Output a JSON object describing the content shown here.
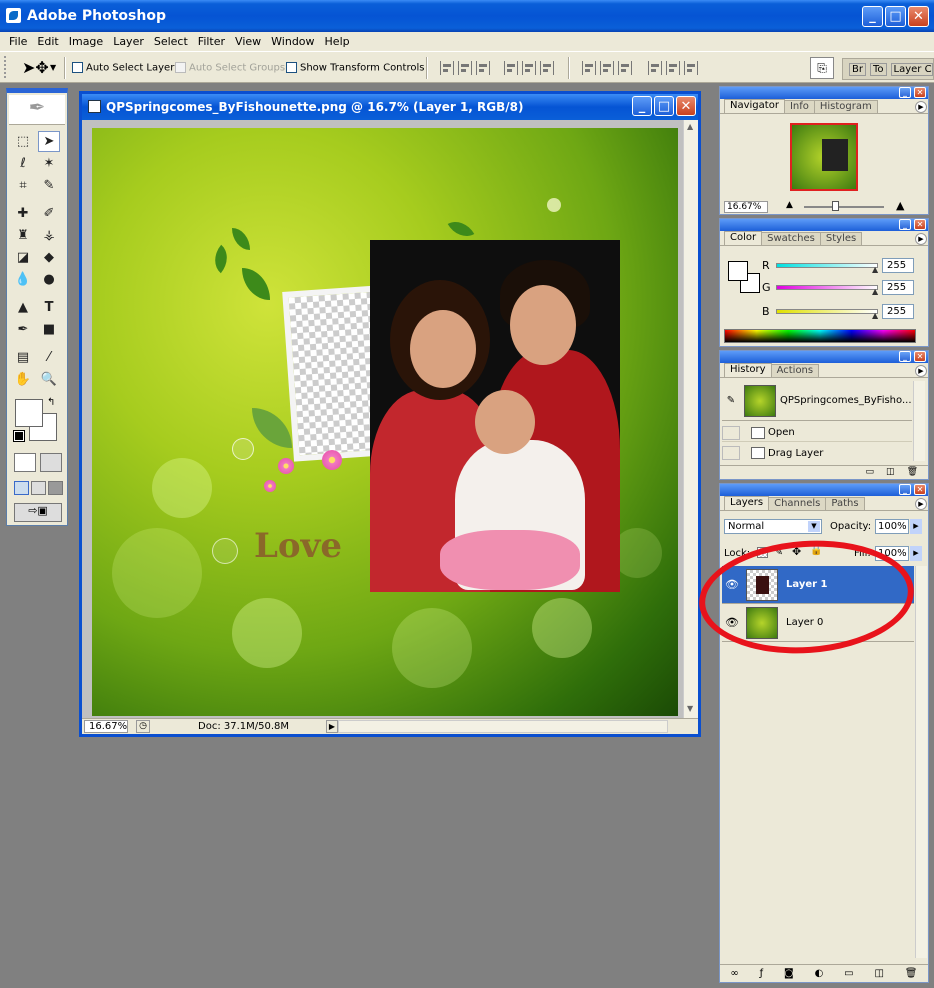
{
  "app": {
    "title": "Adobe Photoshop",
    "window_controls": {
      "minimize": "_",
      "maximize": "□",
      "close": "✕"
    }
  },
  "menu": [
    "File",
    "Edit",
    "Image",
    "Layer",
    "Select",
    "Filter",
    "View",
    "Window",
    "Help"
  ],
  "options_bar": {
    "auto_select_layer": "Auto Select Layer",
    "auto_select_groups": "Auto Select Groups",
    "show_transform_controls": "Show Transform Controls",
    "bridge_tab": "Br",
    "tool_presets_tab": "To",
    "layer_comps_tab": "Layer Co"
  },
  "document": {
    "title": "QPSpringcomes_ByFishounette.png @ 16.7% (Layer 1, RGB/8)",
    "zoom": "16.67%",
    "doc_size": "Doc: 37.1M/50.8M",
    "artwork_text": "Love"
  },
  "navigator": {
    "tabs": [
      "Navigator",
      "Info",
      "Histogram"
    ],
    "zoom": "16.67%"
  },
  "color": {
    "tabs": [
      "Color",
      "Swatches",
      "Styles"
    ],
    "channels": [
      {
        "label": "R",
        "value": "255",
        "color": "#00e0e0"
      },
      {
        "label": "G",
        "value": "255",
        "color": "#e000e0"
      },
      {
        "label": "B",
        "value": "255",
        "color": "#e0e000"
      }
    ]
  },
  "history": {
    "tabs": [
      "History",
      "Actions"
    ],
    "snapshot": "QPSpringcomes_ByFisho...",
    "states": [
      "Open",
      "Drag Layer"
    ]
  },
  "layers": {
    "tabs": [
      "Layers",
      "Channels",
      "Paths"
    ],
    "blend_mode": "Normal",
    "opacity_label": "Opacity:",
    "opacity": "100%",
    "lock_label": "Lock:",
    "fill_label": "Fill:",
    "fill": "100%",
    "items": [
      {
        "name": "Layer 1",
        "selected": true
      },
      {
        "name": "Layer 0",
        "selected": false
      }
    ]
  },
  "colors": {
    "xp_blue": "#0554d4",
    "panel": "#ece9d8",
    "selected_layer": "#3169c6",
    "annotation_red": "#e8131b"
  }
}
